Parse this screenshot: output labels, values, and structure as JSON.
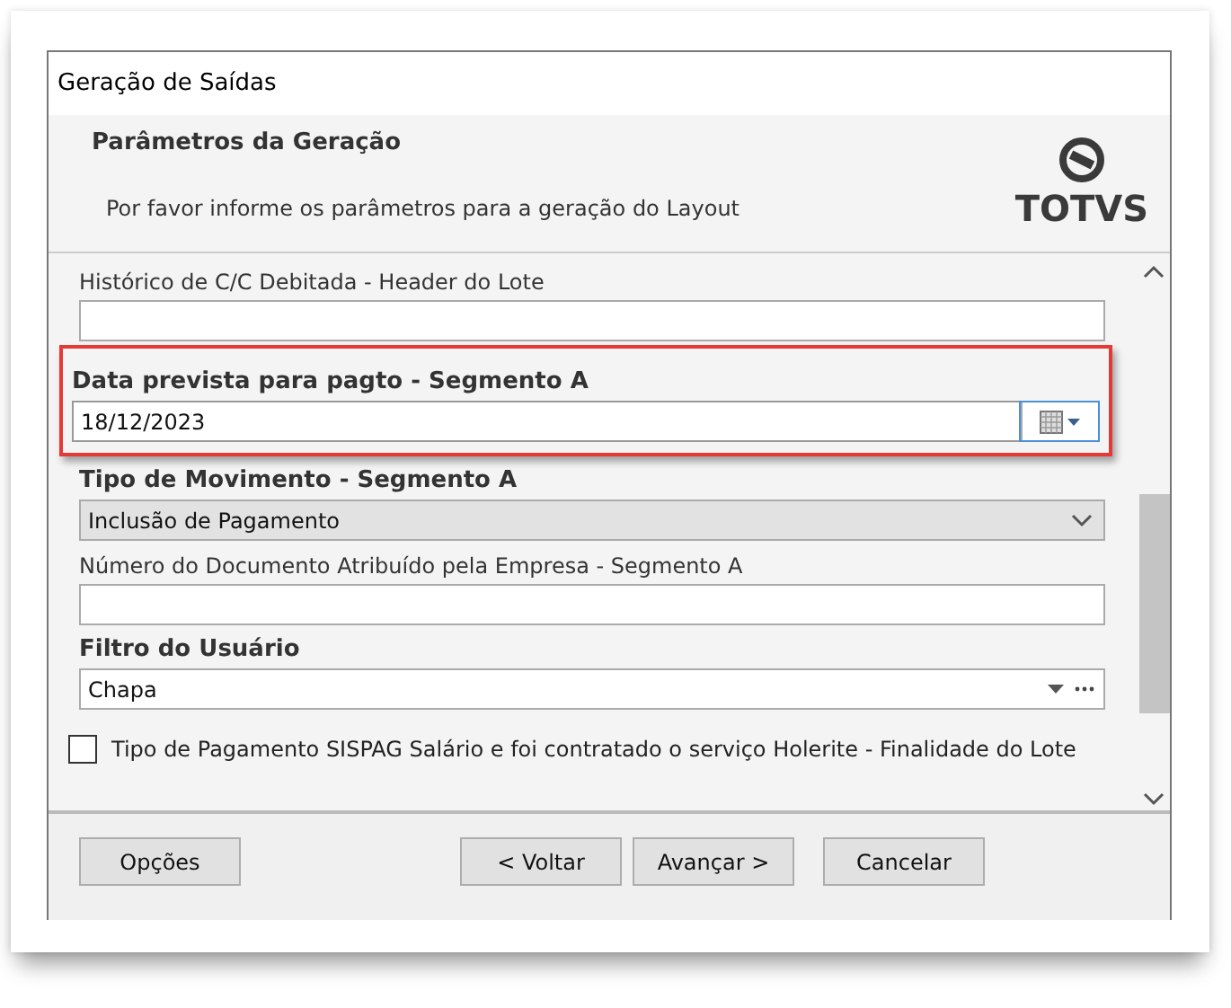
{
  "dialog": {
    "title": "Geração de Saídas"
  },
  "header": {
    "title": "Parâmetros da Geração",
    "subtitle": "Por favor informe os parâmetros para a geração do Layout",
    "logo": "TOTVS"
  },
  "fields": [
    {
      "kind": "text",
      "label": "Histórico de C/C Debitada - Header do Lote",
      "bold": false
    },
    {
      "kind": "date",
      "label": "Data prevista para pagto - Segmento A",
      "bold": true,
      "highlighted": true,
      "value": "18/12/2023"
    },
    {
      "kind": "select",
      "label": "Tipo de Movimento - Segmento A",
      "bold": true,
      "value": "Inclusão de Pagamento"
    },
    {
      "kind": "text",
      "label": "Número do Documento Atribuído pela Empresa - Segmento A",
      "bold": false
    },
    {
      "kind": "lookup",
      "label": "Filtro do Usuário",
      "bold": true,
      "value": "Chapa"
    },
    {
      "kind": "checkbox",
      "label": "Tipo de Pagamento SISPAG Salário e foi contratado o serviço Holerite - Finalidade do Lote",
      "checked": false
    }
  ],
  "buttons": [
    "Opções",
    "< Voltar",
    "Avançar >",
    "Cancelar"
  ]
}
